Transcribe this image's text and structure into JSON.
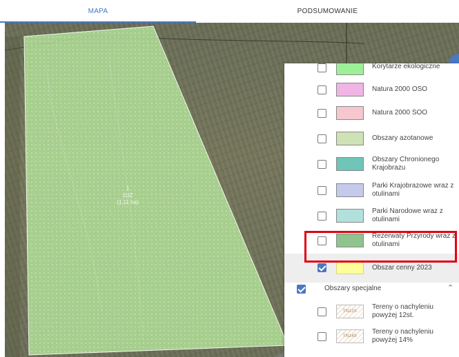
{
  "tabs": [
    {
      "label": "MAPA"
    },
    {
      "label": "PODSUMOWANIE"
    }
  ],
  "parcel": {
    "line1": "1",
    "line2": "1UZ",
    "line3": "(1,11 ha)"
  },
  "legend": {
    "items": [
      {
        "label": "Korytarze ekologiczne",
        "color": "#9ef098",
        "checked": false
      },
      {
        "label": "Natura 2000 OSO",
        "color": "#f0b5e4",
        "checked": false
      },
      {
        "label": "Natura 2000 SOO",
        "color": "#f7c7cf",
        "checked": false
      },
      {
        "label": "Obszary azotanowe",
        "color": "#cfe2b6",
        "checked": false
      },
      {
        "label": "Obszary Chronionego Krajobrazu",
        "color": "#6fc5b8",
        "checked": false
      },
      {
        "label": "Parki Krajobrazowe wraz z otulinami",
        "color": "#c5c9ea",
        "checked": false
      },
      {
        "label": "Parki Narodowe wraz z otulinami",
        "color": "#b2e0dc",
        "checked": false
      },
      {
        "label": "Rezerwaty Przyrody wraz z otulinami",
        "color": "#8fc48e",
        "checked": false
      },
      {
        "label": "Obszar cenny 2023",
        "color": "#fdfd9a",
        "checked": true
      }
    ],
    "group": {
      "label": "Obszary specjalne",
      "checked": true,
      "chevron": "chevron-up-icon"
    },
    "sub_items": [
      {
        "label": "Tereny o nachyleniu powyżej 12st.",
        "code": "TN12S",
        "checked": false
      },
      {
        "label": "Tereny o nachyleniu powyżej 14%",
        "code": "TN14S",
        "checked": false
      }
    ]
  },
  "colors": {
    "accent": "#4a78c2",
    "highlight": "#e0000f",
    "parcel_fill": "#b3e39a"
  }
}
